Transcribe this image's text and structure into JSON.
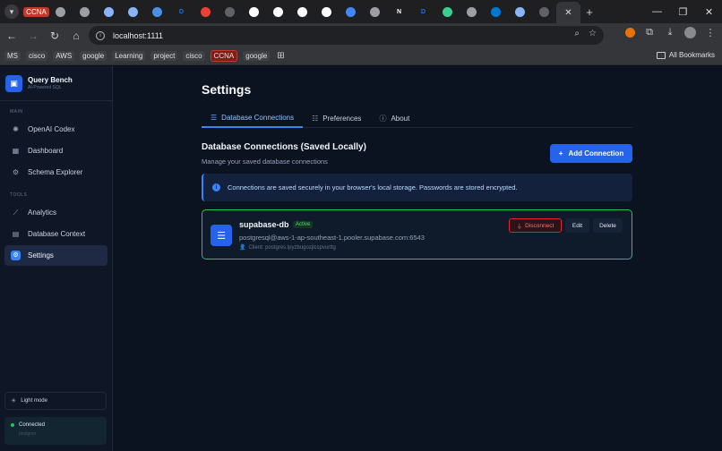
{
  "browser": {
    "tabs": [
      {
        "label": "CCNA",
        "kind": "text",
        "color": "#c0392b"
      },
      {
        "icon": "globe-icon",
        "color": "#9aa0a6"
      },
      {
        "icon": "globe-icon",
        "color": "#9aa0a6"
      },
      {
        "icon": "doc-icon",
        "color": "#8ab4f8"
      },
      {
        "icon": "doc-icon",
        "color": "#8ab4f8"
      },
      {
        "icon": "cloud-icon",
        "color": "#4a90e2"
      },
      {
        "icon": "letter-d-icon",
        "glyph": "D",
        "color": "#1a73e8"
      },
      {
        "icon": "gmail-icon",
        "color": "#ea4335"
      },
      {
        "icon": "link-icon",
        "color": "#5f6368"
      },
      {
        "icon": "github-icon",
        "color": "#ffffff"
      },
      {
        "icon": "chatgpt-icon",
        "color": "#ffffff"
      },
      {
        "icon": "github-icon",
        "color": "#ffffff"
      },
      {
        "icon": "openai-icon",
        "color": "#ffffff"
      },
      {
        "icon": "circle-icon",
        "color": "#4285f4"
      },
      {
        "icon": "globe-icon",
        "color": "#9aa0a6"
      },
      {
        "icon": "notion-icon",
        "glyph": "N",
        "color": "#ffffff"
      },
      {
        "icon": "letter-d-icon",
        "glyph": "D",
        "color": "#1a73e8"
      },
      {
        "icon": "supabase-icon",
        "color": "#3ecf8e"
      },
      {
        "icon": "globe-icon",
        "color": "#9aa0a6"
      },
      {
        "icon": "azure-icon",
        "color": "#0078d4"
      },
      {
        "icon": "doc-icon",
        "color": "#8ab4f8"
      },
      {
        "icon": "link-icon",
        "color": "#5f6368"
      },
      {
        "icon": "close-icon",
        "active": true
      }
    ],
    "url": "localhost:1111",
    "bookmarks": [
      "MS",
      "cisco",
      "AWS",
      "google",
      "Learning",
      "project",
      "cisco",
      "CCNA",
      "google"
    ],
    "all_bookmarks": "All Bookmarks"
  },
  "sidebar": {
    "brand_name": "Query Bench",
    "brand_sub": "AI-Powered SQL",
    "main_label": "MAIN",
    "main_items": [
      {
        "label": "OpenAI Codex",
        "icon": "openai-icon",
        "glyph": "✺"
      },
      {
        "label": "Dashboard",
        "icon": "dashboard-icon",
        "glyph": "▦"
      },
      {
        "label": "Schema Explorer",
        "icon": "schema-icon",
        "glyph": "⚙"
      }
    ],
    "tools_label": "TOOLS",
    "tool_items": [
      {
        "label": "Analytics",
        "icon": "analytics-icon",
        "glyph": "⟋"
      },
      {
        "label": "Database Context",
        "icon": "document-icon",
        "glyph": "▤"
      },
      {
        "label": "Settings",
        "icon": "gear-icon",
        "glyph": "⚙",
        "active": true
      }
    ],
    "light_mode": "Light mode",
    "status": "Connected",
    "status_sub": "postgres"
  },
  "main": {
    "title": "Settings",
    "tabs": [
      {
        "label": "Database Connections",
        "icon": "list-icon",
        "glyph": "☰",
        "active": true
      },
      {
        "label": "Preferences",
        "icon": "sliders-icon",
        "glyph": "☷"
      },
      {
        "label": "About",
        "icon": "info-icon",
        "glyph": "ⓘ"
      }
    ],
    "section_title": "Database Connections (Saved Locally)",
    "section_sub": "Manage your saved database connections",
    "add_button": "Add Connection",
    "info": "Connections are saved securely in your browser's local storage. Passwords are stored encrypted.",
    "connection": {
      "name": "supabase-db",
      "status": "Active",
      "url": "postgresql@aws-1-ap-southeast-1.pooler.supabase.com:6543",
      "client": "Client: postgres.lpyzbugozjlcspvurttg",
      "disconnect": "Disconnect",
      "edit": "Edit",
      "delete": "Delete"
    }
  },
  "colors": {
    "accent": "#2563eb",
    "success": "#22c55e",
    "danger": "#dc2626"
  }
}
